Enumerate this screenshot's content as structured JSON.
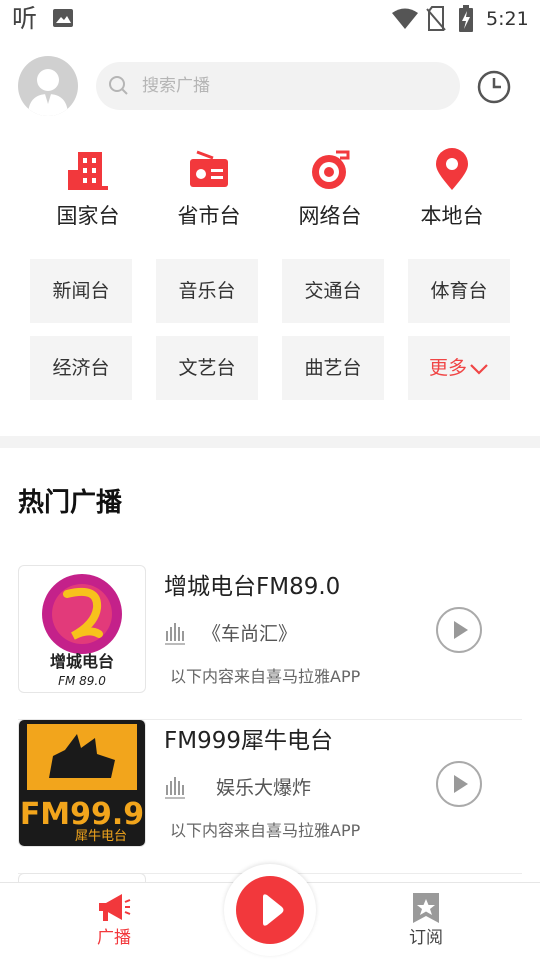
{
  "statusbar": {
    "app_glyph": "听",
    "time": "5:21"
  },
  "search": {
    "placeholder": "搜索广播"
  },
  "categories": [
    {
      "label": "国家台",
      "icon": "building-icon"
    },
    {
      "label": "省市台",
      "icon": "radio-icon"
    },
    {
      "label": "网络台",
      "icon": "network-disc-icon"
    },
    {
      "label": "本地台",
      "icon": "location-pin-icon"
    }
  ],
  "chips": [
    {
      "label": "新闻台"
    },
    {
      "label": "音乐台"
    },
    {
      "label": "交通台"
    },
    {
      "label": "体育台"
    },
    {
      "label": "经济台"
    },
    {
      "label": "文艺台"
    },
    {
      "label": "曲艺台"
    },
    {
      "label": "更多"
    }
  ],
  "hot": {
    "title": "热门广播",
    "stations": [
      {
        "name": "增城电台FM89.0",
        "program": "《车尚汇》",
        "source": "以下内容来自喜马拉雅APP",
        "logo_text": "增城电台",
        "logo_sub": "FM 89.0"
      },
      {
        "name": "FM999犀牛电台",
        "program": "娱乐大爆炸",
        "source": "以下内容来自喜马拉雅APP",
        "logo_text": "FM99.9",
        "logo_sub": "犀牛电台"
      }
    ]
  },
  "nav": {
    "broadcast_label": "广播",
    "subscribe_label": "订阅"
  },
  "colors": {
    "accent": "#f2383c",
    "chip_bg": "#f4f4f4",
    "muted": "#b5b5b5"
  }
}
